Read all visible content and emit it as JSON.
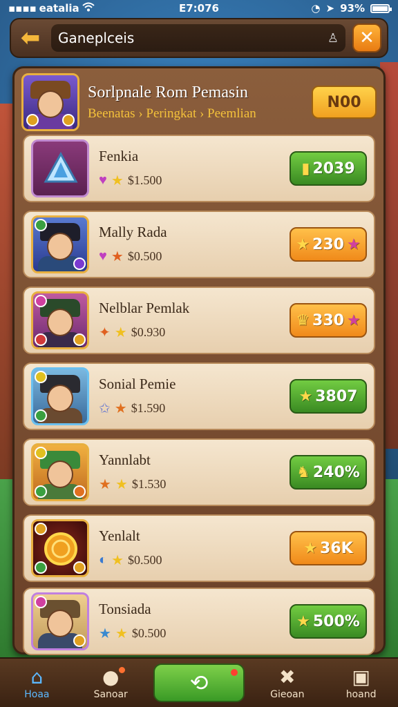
{
  "status_bar": {
    "carrier": "eatalia",
    "time": "E7:076",
    "battery": "93%",
    "battery_level": 0.93,
    "icons": [
      "wifi-icon",
      "location-icon",
      "alarm-icon"
    ]
  },
  "header": {
    "search_text": "Ganeplceis",
    "back_icon": "arrow-left-icon",
    "close_icon": "close-icon"
  },
  "panel_header": {
    "title": "Sorlpnale Rom Pemasin",
    "subtitle": "Beenatas › Peringkat › Peemlian",
    "button_label": "N00"
  },
  "rows": [
    {
      "name": "Fenkia",
      "stat": "$1.500",
      "button": "2039",
      "button_style": "green"
    },
    {
      "name": "Mally Rada",
      "stat": "$0.500",
      "button": "230",
      "button_style": "orange"
    },
    {
      "name": "Nelblar Pemlak",
      "stat": "$0.930",
      "button": "330",
      "button_style": "orange"
    },
    {
      "name": "Sonial Pemie",
      "stat": "$1.590",
      "button": "3807",
      "button_style": "green"
    },
    {
      "name": "Yannlabt",
      "stat": "$1.530",
      "button": "240%",
      "button_style": "green"
    },
    {
      "name": "Yenlalt",
      "stat": "$0.500",
      "button": "36K",
      "button_style": "orange"
    },
    {
      "name": "Tonsiada",
      "stat": "$0.500",
      "button": "500%",
      "button_style": "green"
    }
  ],
  "nav": {
    "home": "Hoaa",
    "search": "Sanoar",
    "center_icon": "swap-icon",
    "battle": "Gieoan",
    "board": "hoand"
  },
  "colors": {
    "accent_orange": "#f0a020",
    "accent_green": "#3a8a22",
    "panel_brown": "#6a4028",
    "active_blue": "#5cb8ff"
  }
}
